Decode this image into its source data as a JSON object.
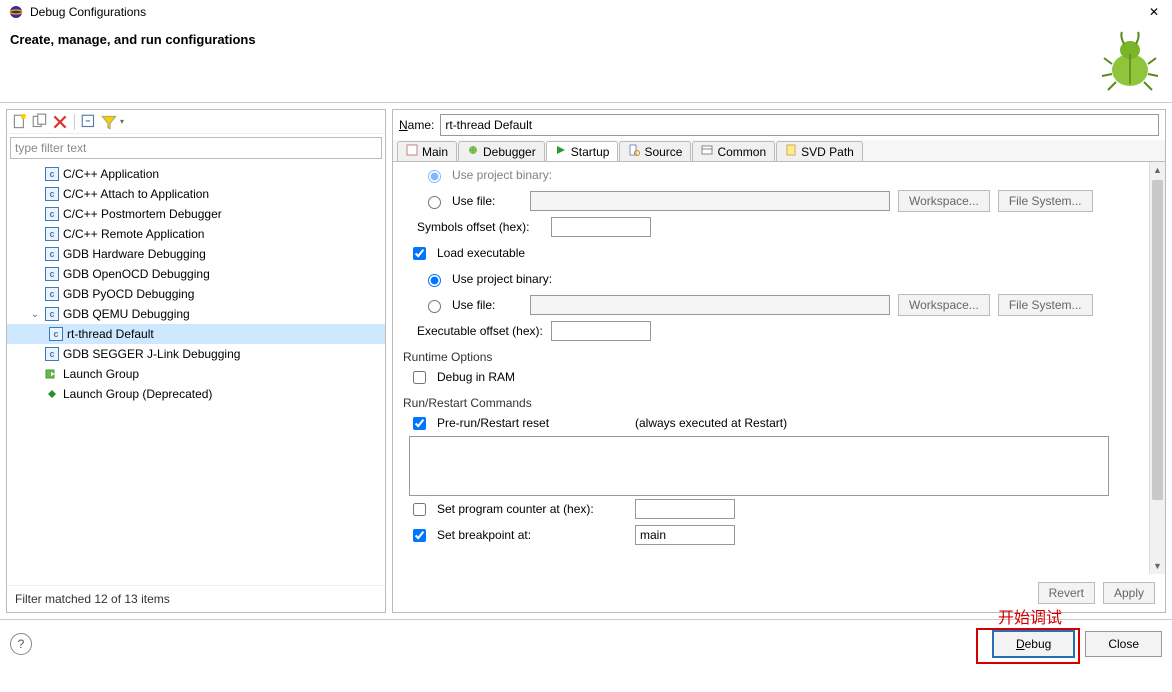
{
  "window": {
    "title": "Debug Configurations",
    "close_glyph": "✕"
  },
  "header": {
    "subtitle": "Create, manage, and run configurations"
  },
  "left": {
    "filter_placeholder": "type filter text",
    "tree": [
      {
        "label": "C/C++ Application",
        "kind": "c"
      },
      {
        "label": "C/C++ Attach to Application",
        "kind": "c"
      },
      {
        "label": "C/C++ Postmortem Debugger",
        "kind": "c"
      },
      {
        "label": "C/C++ Remote Application",
        "kind": "c"
      },
      {
        "label": "GDB Hardware Debugging",
        "kind": "c"
      },
      {
        "label": "GDB OpenOCD Debugging",
        "kind": "c"
      },
      {
        "label": "GDB PyOCD Debugging",
        "kind": "c"
      },
      {
        "label": "GDB QEMU Debugging",
        "kind": "c",
        "expanded": true
      },
      {
        "label": "rt-thread Default",
        "kind": "c",
        "child": true,
        "selected": true
      },
      {
        "label": "GDB SEGGER J-Link Debugging",
        "kind": "c"
      },
      {
        "label": "Launch Group",
        "kind": "launch"
      },
      {
        "label": "Launch Group (Deprecated)",
        "kind": "launch-dep"
      }
    ],
    "footer_status": "Filter matched 12 of 13 items"
  },
  "right": {
    "name_label_prefix": "N",
    "name_label_rest": "ame:",
    "name_value": "rt-thread Default",
    "tabs": [
      "Main",
      "Debugger",
      "Startup",
      "Source",
      "Common",
      "SVD Path"
    ],
    "active_tab_index": 2,
    "form": {
      "use_project_binary": "Use project binary:",
      "use_file": "Use file:",
      "workspace_btn": "Workspace...",
      "filesystem_btn": "File System...",
      "symbols_offset": "Symbols offset (hex):",
      "load_executable": "Load executable",
      "executable_offset": "Executable offset (hex):",
      "runtime_options": "Runtime Options",
      "debug_in_ram": "Debug in RAM",
      "run_restart": "Run/Restart Commands",
      "pre_run_reset": "Pre-run/Restart reset",
      "always_exec": "(always executed at Restart)",
      "set_pc": "Set program counter at (hex):",
      "set_bp": "Set breakpoint at:",
      "bp_value": "main"
    },
    "revert_btn": "Revert",
    "apply_btn": "Apply"
  },
  "footer": {
    "debug_btn_prefix": "D",
    "debug_btn_rest": "ebug",
    "close_btn": "Close"
  },
  "annotation": {
    "label": "开始调试"
  }
}
